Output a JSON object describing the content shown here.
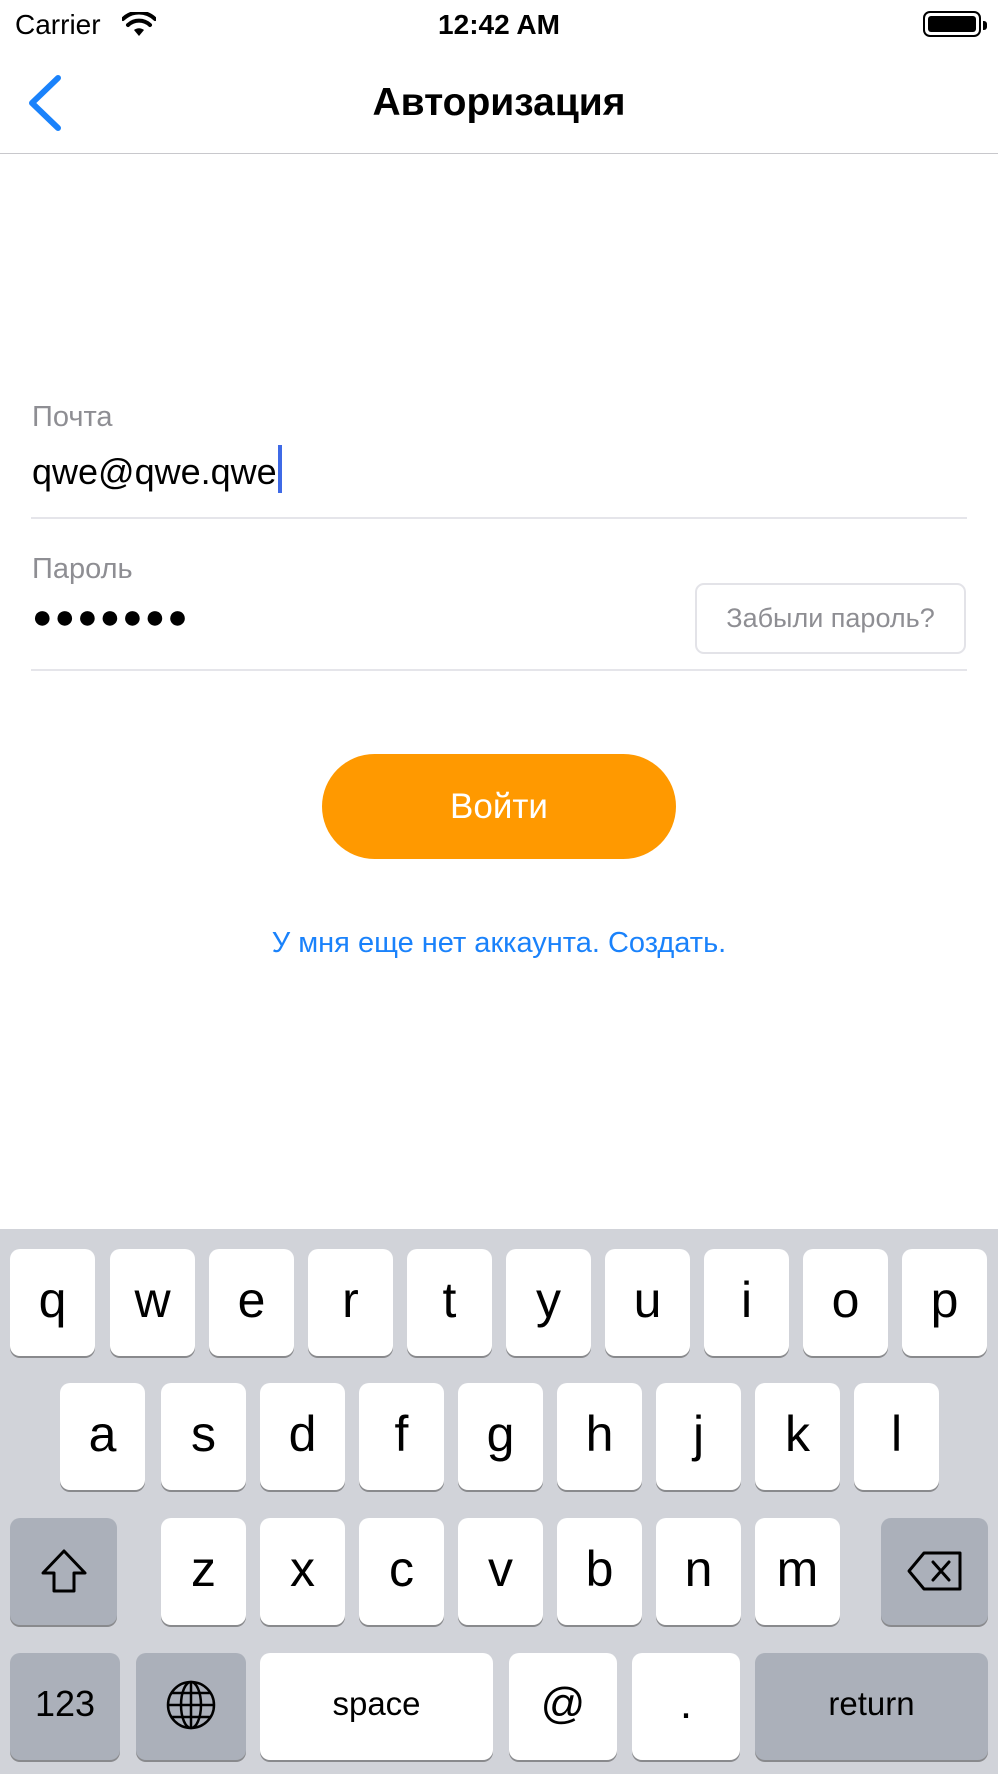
{
  "status_bar": {
    "carrier": "Carrier",
    "time": "12:42 AM",
    "wifi_icon": "wifi-icon",
    "battery_icon": "battery-icon"
  },
  "nav": {
    "title": "Авторизация",
    "back_icon": "chevron-left-icon"
  },
  "form": {
    "email_label": "Почта",
    "email_value": "qwe@qwe.qwe",
    "password_label": "Пароль",
    "password_value": "●●●●●●●",
    "forgot_label": "Забыли пароль?",
    "login_label": "Войти",
    "register_label": "У мня еще нет аккаунта. Создать."
  },
  "colors": {
    "accent_orange": "#FF9900",
    "link_blue": "#1A82FB",
    "caret_blue": "#3F6AE6",
    "keyboard_bg": "#D1D3D9"
  },
  "keyboard": {
    "row1": [
      "q",
      "w",
      "e",
      "r",
      "t",
      "y",
      "u",
      "i",
      "o",
      "p"
    ],
    "row2": [
      "a",
      "s",
      "d",
      "f",
      "g",
      "h",
      "j",
      "k",
      "l"
    ],
    "row3": [
      "z",
      "x",
      "c",
      "v",
      "b",
      "n",
      "m"
    ],
    "shift_icon": "shift-icon",
    "delete_icon": "backspace-icon",
    "globe_icon": "globe-icon",
    "numbers_label": "123",
    "space_label": "space",
    "at_label": "@",
    "dot_label": ".",
    "return_label": "return"
  }
}
